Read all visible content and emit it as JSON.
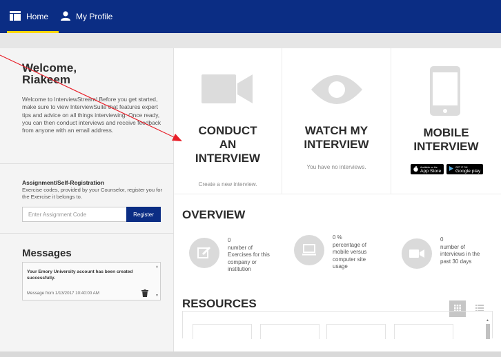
{
  "nav": {
    "home_label": "Home",
    "profile_label": "My Profile"
  },
  "welcome": {
    "title_line1": "Welcome,",
    "title_line2": "Riakeem",
    "body": "Welcome to InterviewStream! Before you get started, make sure to view InterviewSuite that features expert tips and advice on all things interviewing. Once ready, you can then conduct interviews and receive feedback from anyone with an email address."
  },
  "assignment": {
    "title": "Assignment/Self-Registration",
    "description": "Exercise codes, provided by your Counselor, register you for the Exercise it belongs to.",
    "placeholder": "Enter Assignment Code",
    "register_label": "Register"
  },
  "messages": {
    "title": "Messages",
    "items": [
      {
        "text": "Your Emory University account has been created successfully.",
        "meta": "Message from 1/13/2017 10:40:00 AM"
      }
    ]
  },
  "cards": [
    {
      "title_line1": "CONDUCT",
      "title_line2": "AN",
      "title_line3": "INTERVIEW",
      "subtitle": "Create a new interview."
    },
    {
      "title_line1": "WATCH MY",
      "title_line2": "INTERVIEW",
      "subtitle": "You have no interviews."
    },
    {
      "title_line1": "MOBILE",
      "title_line2": "INTERVIEW",
      "appstore_small": "Available on the",
      "appstore_label": "App Store",
      "googleplay_small": "GET IT ON",
      "googleplay_label": "Google play"
    }
  ],
  "overview": {
    "title": "OVERVIEW",
    "stats": [
      {
        "value": "0",
        "label_1": "number of",
        "label_2": "Exercises for this",
        "label_3": "company or",
        "label_4": "institution"
      },
      {
        "value": "0 %",
        "label_1": "percentage of",
        "label_2": "mobile versus",
        "label_3": "computer site",
        "label_4": "usage"
      },
      {
        "value": "0",
        "label_1": "number of",
        "label_2": "interviews in the",
        "label_3": "past 30 days"
      }
    ]
  },
  "resources": {
    "title": "RESOURCES"
  },
  "colors": {
    "nav_bg": "#0b2d84",
    "accent": "#fdd700",
    "annotation_arrow": "#e8202a"
  }
}
